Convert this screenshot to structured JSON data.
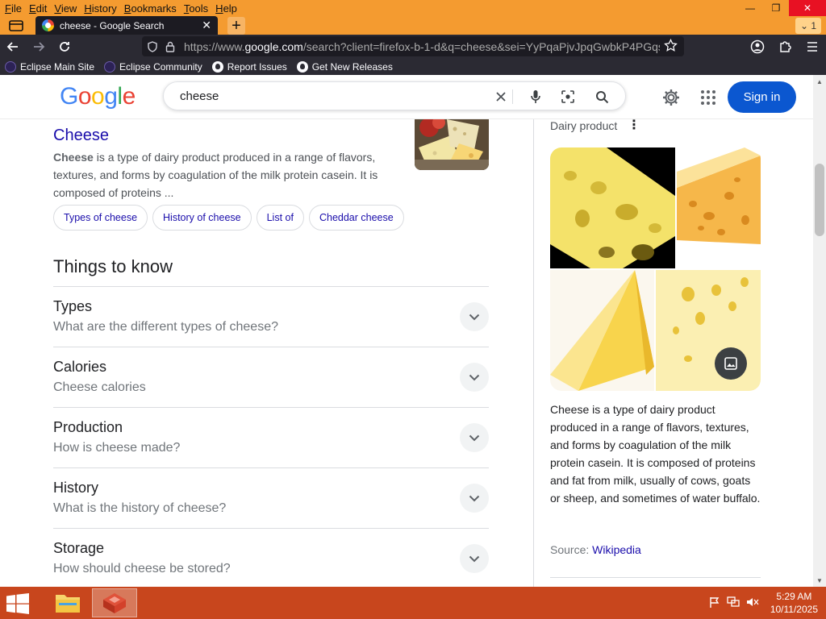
{
  "browser": {
    "menu": [
      "File",
      "Edit",
      "View",
      "History",
      "Bookmarks",
      "Tools",
      "Help"
    ],
    "tab_title": "cheese - Google Search",
    "tab_count": "1",
    "url_prefix": "https://www.",
    "url_domain": "google.com",
    "url_rest": "/search?client=firefox-b-1-d&q=cheese&sei=YyPqaPjvJpqGwbkP4PGqs",
    "bookmarks": [
      "Eclipse Main Site",
      "Eclipse Community",
      "Report Issues",
      "Get New Releases"
    ]
  },
  "google": {
    "query": "cheese",
    "signin_label": "Sign in"
  },
  "result": {
    "title": "Cheese",
    "snippet_bold": "Cheese",
    "snippet_rest": " is a type of dairy product produced in a range of flavors, textures, and forms by coagulation of the milk protein casein. It is composed of proteins ...",
    "chips": [
      "Types of cheese",
      "History of cheese",
      "List of",
      "Cheddar cheese"
    ]
  },
  "things_to_know": {
    "title": "Things to know",
    "items": [
      {
        "title": "Types",
        "subtitle": "What are the different types of cheese?"
      },
      {
        "title": "Calories",
        "subtitle": "Cheese calories"
      },
      {
        "title": "Production",
        "subtitle": "How is cheese made?"
      },
      {
        "title": "History",
        "subtitle": "What is the history of cheese?"
      },
      {
        "title": "Storage",
        "subtitle": "How should cheese be stored?"
      }
    ]
  },
  "knowledge_panel": {
    "subtitle": "Dairy product",
    "description": "Cheese is a type of dairy product produced in a range of flavors, textures, and forms by coagulation of the milk protein casein. It is composed of proteins and fat from milk, usually of cows, goats or sheep, and sometimes of water buffalo.",
    "source_label": "Source:",
    "source_link": "Wikipedia"
  },
  "taskbar": {
    "time": "5:29 AM",
    "date": "10/11/2025"
  },
  "colors": {
    "firefox_accent": "#f49b30",
    "taskbar": "#c8461d",
    "link": "#1a0dab",
    "signin": "#0b57d0"
  }
}
